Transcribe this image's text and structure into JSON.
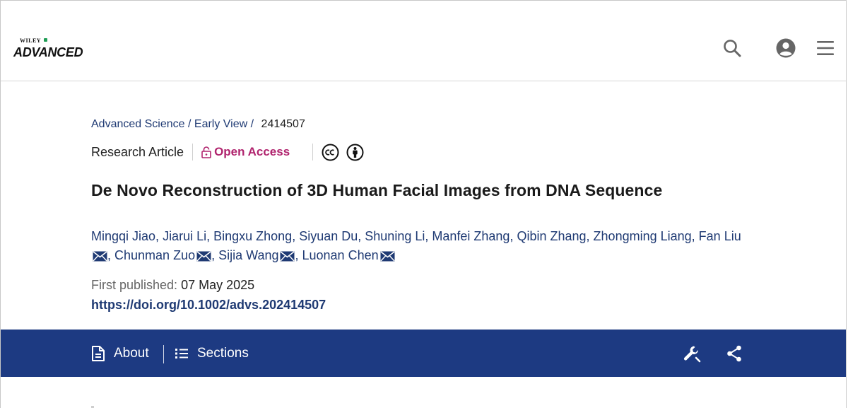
{
  "header": {
    "logo_small": "WILEY",
    "logo_main": "ADVANCED",
    "icons": [
      "search-icon",
      "account-icon",
      "menu-icon"
    ]
  },
  "breadcrumb": {
    "journal": "Advanced Science",
    "section": "Early View",
    "separator": "/",
    "current": "2414507"
  },
  "meta": {
    "article_type": "Research Article",
    "open_access": "Open Access",
    "license_icons": [
      "cc-icon",
      "by-attribution-icon"
    ]
  },
  "title": "De Novo Reconstruction of 3D Human Facial Images from DNA Sequence",
  "authors": [
    {
      "name": "Mingqi Jiao",
      "email": false
    },
    {
      "name": "Jiarui Li",
      "email": false
    },
    {
      "name": "Bingxu Zhong",
      "email": false
    },
    {
      "name": "Siyuan Du",
      "email": false
    },
    {
      "name": "Shuning Li",
      "email": false
    },
    {
      "name": "Manfei Zhang",
      "email": false
    },
    {
      "name": "Qibin Zhang",
      "email": false
    },
    {
      "name": "Zhongming Liang",
      "email": false
    },
    {
      "name": "Fan Liu",
      "email": true
    },
    {
      "name": "Chunman Zuo",
      "email": true
    },
    {
      "name": "Sijia Wang",
      "email": true
    },
    {
      "name": "Luonan Chen",
      "email": true
    }
  ],
  "published": {
    "label": "First published:",
    "date": "07 May 2025"
  },
  "doi": "https://doi.org/10.1002/advs.202414507",
  "article_bar": {
    "about": "About",
    "sections": "Sections",
    "icons": [
      "tools-icon",
      "share-icon"
    ]
  },
  "colors": {
    "link": "#1f3a73",
    "open_access": "#b0246e",
    "bar": "#1d3a82"
  }
}
